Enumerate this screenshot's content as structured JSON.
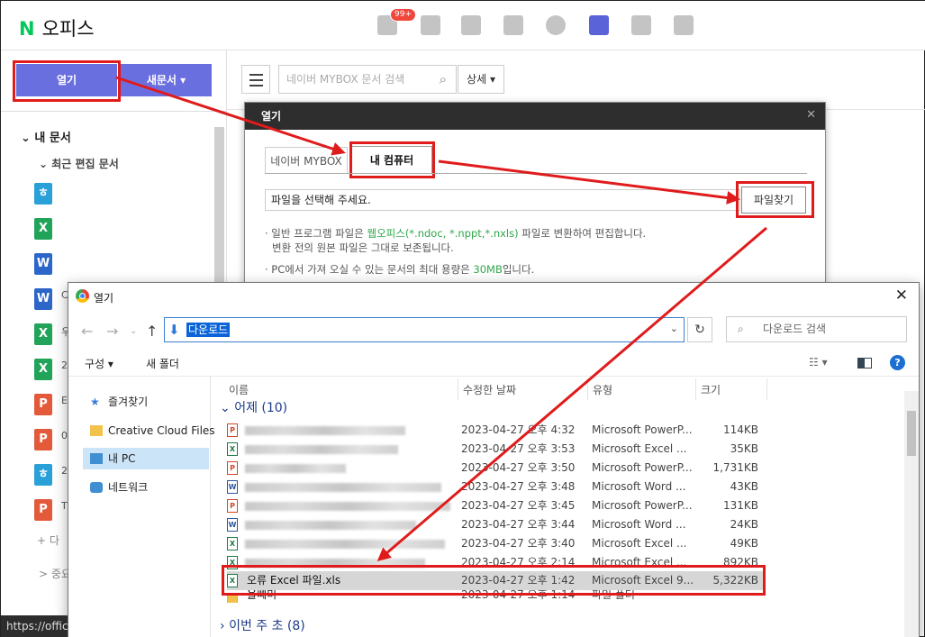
{
  "app": {
    "logo_letter": "N",
    "title": "오피스",
    "notification_badge": "99+"
  },
  "header_icons": [
    "mail-icon",
    "calendar-icon",
    "list-icon",
    "contacts-icon",
    "cube-icon",
    "office-icon",
    "home-icon",
    "flag-icon"
  ],
  "sidebar": {
    "open_label": "열기",
    "new_label": "새문서",
    "my_docs": "내 문서",
    "recent": "최근 편집 문서",
    "docs": [
      {
        "letter": "ㅎ",
        "color": "#2aa0d8",
        "sub": ""
      },
      {
        "letter": "X",
        "color": "#21a35a",
        "sub": ""
      },
      {
        "letter": "W",
        "color": "#2b66c8",
        "sub": ""
      },
      {
        "letter": "W",
        "color": "#2b66c8",
        "sub": "C"
      },
      {
        "letter": "X",
        "color": "#21a35a",
        "sub": "우"
      },
      {
        "letter": "X",
        "color": "#21a35a",
        "sub": "2"
      },
      {
        "letter": "P",
        "color": "#e35a3a",
        "sub": "E"
      },
      {
        "letter": "P",
        "color": "#e35a3a",
        "sub": "0"
      },
      {
        "letter": "ㅎ",
        "color": "#2aa0d8",
        "sub": "2"
      },
      {
        "letter": "P",
        "color": "#e35a3a",
        "sub": "T"
      }
    ],
    "add_label": "+ 다",
    "important_label": "> 중요"
  },
  "search": {
    "placeholder": "네이버 MYBOX 문서 검색",
    "detail": "상세"
  },
  "open_dialog": {
    "title": "열기",
    "tab_mybox": "네이버 MYBOX",
    "tab_mypc": "내 컴퓨터",
    "file_placeholder": "파일을 선택해 주세요.",
    "find_button": "파일찾기",
    "note1_a": "· 일반 프로그램 파일은 ",
    "note1_g": "웹오피스(*.ndoc, *.nppt,*.nxls)",
    "note1_b": " 파일로 변환하여 편집합니다.",
    "note2": "변환 전의 원본 파일은 그대로 보존됩니다.",
    "note3_a": "· PC에서 가져 오실 수 있는 문서의 최대 용량은 ",
    "note3_g": "30MB",
    "note3_b": "입니다."
  },
  "file_dialog": {
    "title": "열기",
    "address": "다운로드",
    "search_placeholder": "다운로드 검색",
    "organize": "구성 ▾",
    "new_folder": "새 폴더",
    "nav": {
      "favorites": "즐겨찾기",
      "creative_cloud": "Creative Cloud Files",
      "this_pc": "내 PC",
      "network": "네트워크"
    },
    "columns": {
      "name": "이름",
      "modified": "수정한 날짜",
      "type": "유형",
      "size": "크기"
    },
    "group_yesterday": "어제 (10)",
    "group_this_week": "이번 주 초 (8)",
    "rows": [
      {
        "icon": "P",
        "color": "#d24726",
        "blur": 178,
        "date": "2023-04-27 오후 4:32",
        "type": "Microsoft PowerP...",
        "size": "114KB"
      },
      {
        "icon": "X",
        "color": "#1d7a45",
        "blur": 170,
        "date": "2023-04-27 오후 3:53",
        "type": "Microsoft Excel ...",
        "size": "35KB"
      },
      {
        "icon": "P",
        "color": "#d24726",
        "blur": 112,
        "date": "2023-04-27 오후 3:50",
        "type": "Microsoft PowerP...",
        "size": "1,731KB"
      },
      {
        "icon": "W",
        "color": "#2b579a",
        "blur": 218,
        "date": "2023-04-27 오후 3:48",
        "type": "Microsoft Word ...",
        "size": "43KB"
      },
      {
        "icon": "P",
        "color": "#d24726",
        "blur": 228,
        "date": "2023-04-27 오후 3:45",
        "type": "Microsoft PowerP...",
        "size": "131KB"
      },
      {
        "icon": "W",
        "color": "#2b579a",
        "blur": 190,
        "date": "2023-04-27 오후 3:44",
        "type": "Microsoft Word ...",
        "size": "24KB"
      },
      {
        "icon": "X",
        "color": "#1d7a45",
        "blur": 222,
        "date": "2023-04-27 오후 3:40",
        "type": "Microsoft Excel ...",
        "size": "49KB"
      },
      {
        "icon": "X",
        "color": "#1d7a45",
        "blur": 200,
        "date": "2023-04-27 오후 2:14",
        "type": "Microsoft Excel ...",
        "size": "892KB"
      }
    ],
    "selected_row": {
      "name": "오류 Excel 파일.xls",
      "date": "2023-04-27 오후 1:42",
      "type": "Microsoft Excel 9...",
      "size": "5,322KB"
    },
    "folder_row": {
      "name": "올빼미",
      "date": "2023-04-27 오후 1:14",
      "type": "파일 폴더"
    }
  },
  "status_url": "https://office"
}
